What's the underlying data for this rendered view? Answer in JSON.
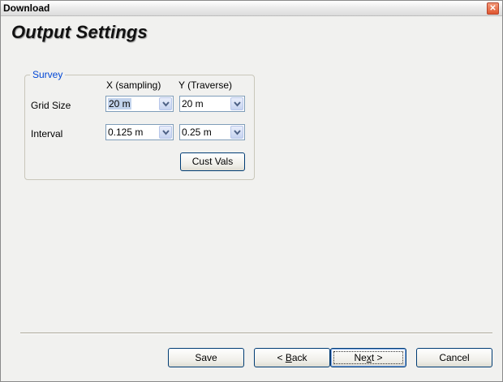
{
  "window": {
    "title": "Download"
  },
  "page": {
    "heading": "Output Settings"
  },
  "survey": {
    "legend": "Survey",
    "col_x": "X (sampling)",
    "col_y": "Y (Traverse)",
    "grid_size_label": "Grid Size",
    "interval_label": "Interval",
    "grid_x": "20 m",
    "grid_y": "20 m",
    "interval_x": "0.125 m",
    "interval_y": "0.25 m",
    "cust_vals_label": "Cust Vals"
  },
  "buttons": {
    "save": "Save",
    "back_prefix": "< ",
    "back_key": "B",
    "back_rest": "ack",
    "next_prefix": "Ne",
    "next_key": "x",
    "next_rest": "t >",
    "cancel": "Cancel"
  }
}
